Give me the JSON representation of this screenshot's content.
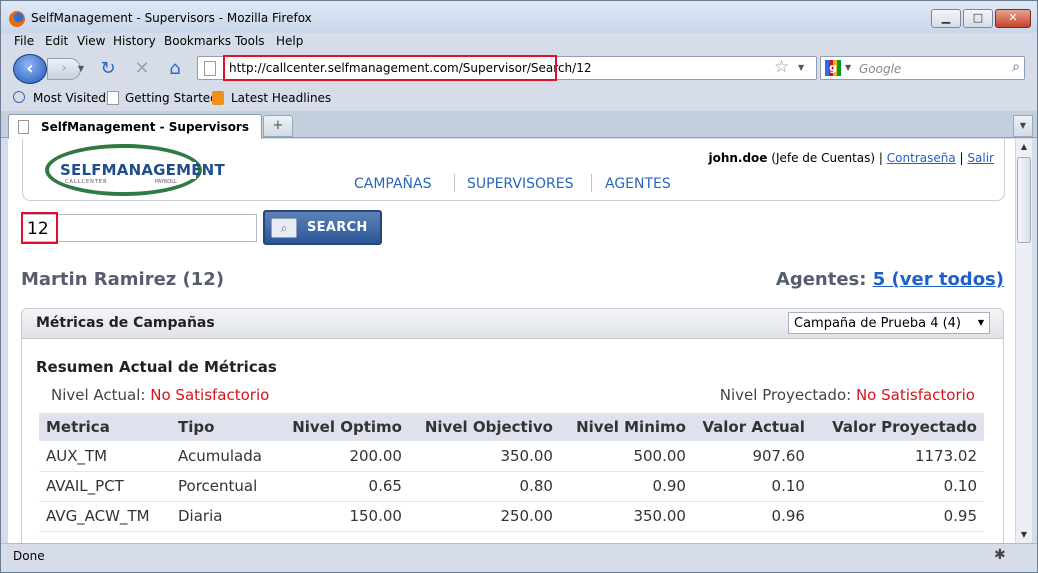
{
  "window": {
    "title": "SelfManagement - Supervisors - Mozilla Firefox"
  },
  "menu": [
    "File",
    "Edit",
    "View",
    "History",
    "Bookmarks",
    "Tools",
    "Help"
  ],
  "url": "http://callcenter.selfmanagement.com/Supervisor/Search/12",
  "search_engine": {
    "placeholder": "Google"
  },
  "bookmarks": [
    "Most Visited",
    "Getting Started",
    "Latest Headlines"
  ],
  "tab": {
    "title": "SelfManagement - Supervisors"
  },
  "status": "Done",
  "page": {
    "logo": {
      "name": "SELFMANAGEMENT",
      "left": "CALLCENTER",
      "right": "PAYROLL"
    },
    "nav": [
      "CAMPAÑAS",
      "SUPERVISORES",
      "AGENTES"
    ],
    "user": {
      "name": "john.doe",
      "role": "(Jefe de Cuentas)",
      "sep": "|",
      "password": "Contraseña",
      "logout": "Salir"
    },
    "search": {
      "value": "12",
      "button": "SEARCH"
    },
    "person": "Martin Ramirez (12)",
    "agents": {
      "label": "Agentes:",
      "link": "5 (ver todos)"
    },
    "panel": {
      "title": "Métricas de Campañas",
      "campaign": "Campaña de Prueba 4 (4)",
      "section": "Resumen Actual de Métricas",
      "current_level": {
        "label": "Nivel Actual:",
        "value": "No Satisfactorio"
      },
      "projected_level": {
        "label": "Nivel Proyectado:",
        "value": "No Satisfactorio"
      },
      "columns": [
        "Metrica",
        "Tipo",
        "Nivel Optimo",
        "Nivel Objectivo",
        "Nivel Minimo",
        "Valor Actual",
        "Valor Proyectado"
      ],
      "rows": [
        [
          "AUX_TM",
          "Acumulada",
          "200.00",
          "350.00",
          "500.00",
          "907.60",
          "1173.02"
        ],
        [
          "AVAIL_PCT",
          "Porcentual",
          "0.65",
          "0.80",
          "0.90",
          "0.10",
          "0.10"
        ],
        [
          "AVG_ACW_TM",
          "Diaria",
          "150.00",
          "250.00",
          "350.00",
          "0.96",
          "0.95"
        ]
      ]
    }
  },
  "colors": {
    "accent": "#2060c8",
    "alert": "#d8141a",
    "highlight": "#e0102a"
  }
}
